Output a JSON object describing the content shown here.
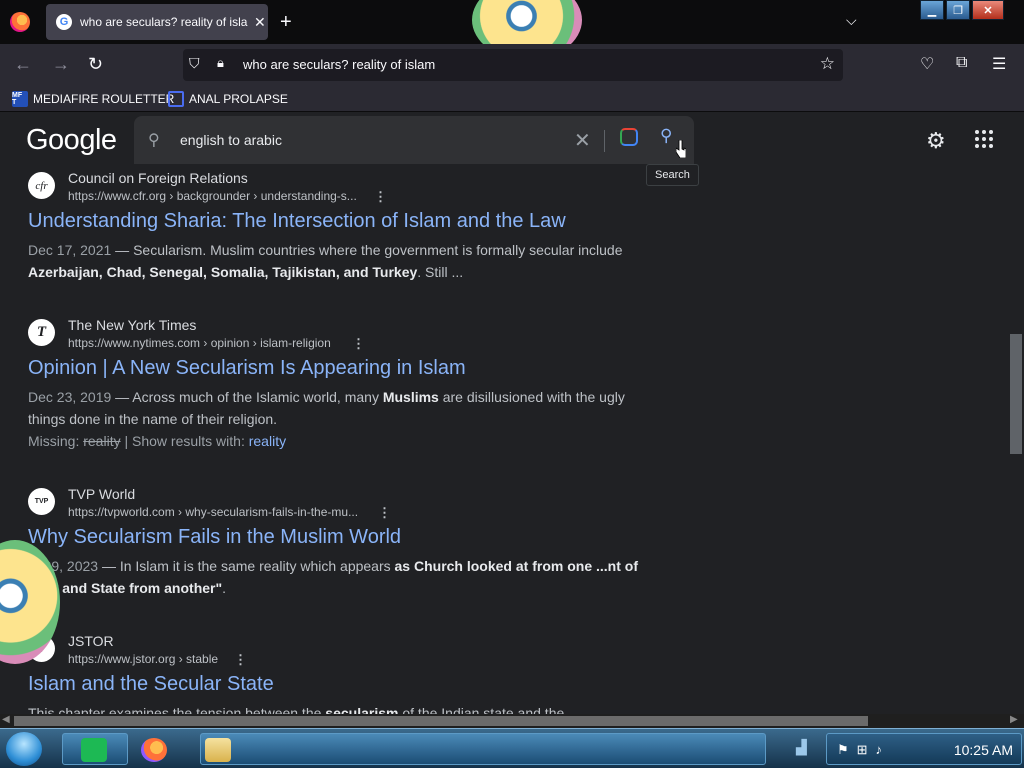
{
  "browser": {
    "tab_title": "who are seculars? reality of islam",
    "tab_favicon": "G",
    "url": "who are seculars? reality of islam",
    "bookmarks": [
      {
        "label": "MEDIAFIRE ROULETTER",
        "icon_text": "MF T"
      },
      {
        "label": "ANAL PROLAPSE",
        "icon_text": ""
      }
    ]
  },
  "google": {
    "logo": "Google",
    "query": "english to arabic",
    "tooltip": "Search"
  },
  "results": [
    {
      "site": "Council on Foreign Relations",
      "favicon": "cfr",
      "url": "https://www.cfr.org › backgrounder › understanding-s...",
      "title": "Understanding Sharia: The Intersection of Islam and the Law",
      "date": "Dec 17, 2021",
      "snippet_parts": [
        {
          "t": " — Secularism. Muslim countries where the government is formally secular include "
        },
        {
          "t": "Azerbaijan, Chad, Senegal, Somalia, Tajikistan, and Turkey",
          "b": true
        },
        {
          "t": ". Still ..."
        }
      ]
    },
    {
      "site": "The New York Times",
      "favicon": "T",
      "url": "https://www.nytimes.com › opinion › islam-religion",
      "title": "Opinion | A New Secularism Is Appearing in Islam",
      "date": "Dec 23, 2019",
      "snippet_parts": [
        {
          "t": " — Across much of the Islamic world, many "
        },
        {
          "t": "Muslims",
          "b": true
        },
        {
          "t": " are disillusioned with the ugly things done in the name of their religion."
        }
      ],
      "missing": {
        "label": "Missing: ",
        "struck": "reality",
        "sep": " | Show results with: ",
        "link": "reality"
      }
    },
    {
      "site": "TVP World",
      "favicon": "TVP",
      "url": "https://tvpworld.com › why-secularism-fails-in-the-mu...",
      "title": "Why Secularism Fails in the Muslim World",
      "date": "... 29, 2023",
      "snippet_parts": [
        {
          "t": " — In Islam it is the same reality which appears "
        },
        {
          "t": "as Church looked at from one ...nt of view and State from another\"",
          "b": true
        },
        {
          "t": "."
        }
      ]
    },
    {
      "site": "JSTOR",
      "favicon": "J",
      "url": "https://www.jstor.org › stable",
      "title": "Islam and the Secular State",
      "date": "",
      "snippet_parts": [
        {
          "t": "This chapter examines the tension between the "
        },
        {
          "t": "secularism",
          "b": true
        },
        {
          "t": " of the Indian state and the ..."
        }
      ]
    }
  ],
  "taskbar": {
    "clock": "10:25 AM"
  },
  "colors": {
    "page_bg": "#202124",
    "link": "#8ab4f8",
    "text": "#bdc1c6"
  }
}
